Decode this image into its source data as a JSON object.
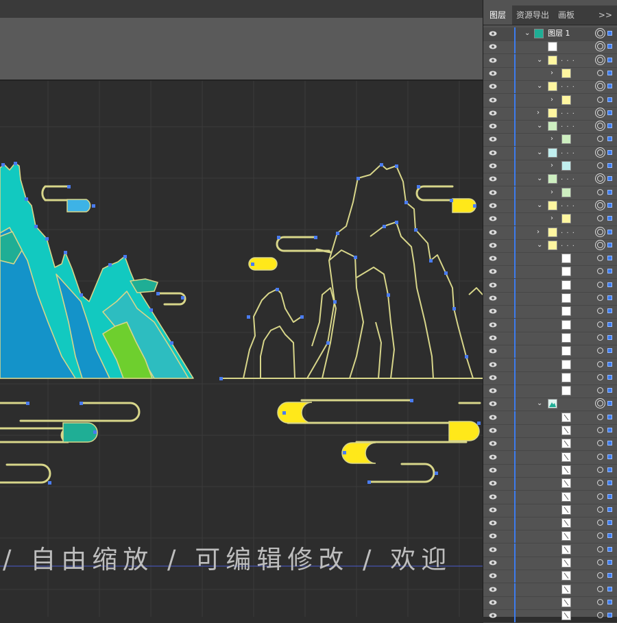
{
  "canvas": {
    "watermark_text": "/ 自由缩放 / 可编辑修改 / 欢迎",
    "colors": {
      "background": "#2d2d2d",
      "grid": "#3a3a3a",
      "outline": "#d8d68a",
      "anchor": "#4a7cf0",
      "teal": "#12c9c0",
      "blue": "#1493c9",
      "green": "#6ecf2e",
      "sky": "#3db3e6",
      "yellow": "#ffe81a",
      "jade": "#1fae95"
    }
  },
  "layers_panel": {
    "tabs": [
      "图层",
      "资源导出",
      "画板"
    ],
    "more_label": ">>",
    "top_layer_name": "图层 1",
    "rows": [
      {
        "indent": 0,
        "chev": "v",
        "thumb": "colored",
        "dots": false,
        "target": "double"
      },
      {
        "indent": 1,
        "chev": "",
        "thumb": "white",
        "dots": false,
        "target": "double"
      },
      {
        "indent": 1,
        "chev": "v",
        "thumb": "yellow",
        "dots": true,
        "target": "double"
      },
      {
        "indent": 2,
        "chev": ">",
        "thumb": "yellow",
        "dots": false,
        "target": "single"
      },
      {
        "indent": 1,
        "chev": "v",
        "thumb": "yellow",
        "dots": true,
        "target": "double"
      },
      {
        "indent": 2,
        "chev": ">",
        "thumb": "yellow",
        "dots": false,
        "target": "single"
      },
      {
        "indent": 1,
        "chev": ">",
        "thumb": "yellow",
        "dots": true,
        "target": "double"
      },
      {
        "indent": 1,
        "chev": "v",
        "thumb": "green",
        "dots": true,
        "target": "double"
      },
      {
        "indent": 2,
        "chev": ">",
        "thumb": "green",
        "dots": false,
        "target": "single"
      },
      {
        "indent": 1,
        "chev": "v",
        "thumb": "teal",
        "dots": true,
        "target": "double"
      },
      {
        "indent": 2,
        "chev": ">",
        "thumb": "teal",
        "dots": false,
        "target": "single"
      },
      {
        "indent": 1,
        "chev": "v",
        "thumb": "green",
        "dots": true,
        "target": "double"
      },
      {
        "indent": 2,
        "chev": ">",
        "thumb": "green",
        "dots": false,
        "target": "single"
      },
      {
        "indent": 1,
        "chev": "v",
        "thumb": "yellow",
        "dots": true,
        "target": "double"
      },
      {
        "indent": 2,
        "chev": ">",
        "thumb": "yellow",
        "dots": false,
        "target": "single"
      },
      {
        "indent": 1,
        "chev": ">",
        "thumb": "yellow",
        "dots": true,
        "target": "double"
      },
      {
        "indent": 1,
        "chev": "v",
        "thumb": "yellow",
        "dots": true,
        "target": "double"
      },
      {
        "indent": 2,
        "chev": "",
        "thumb": "white",
        "dots": false,
        "target": "single"
      },
      {
        "indent": 2,
        "chev": "",
        "thumb": "white",
        "dots": false,
        "target": "single"
      },
      {
        "indent": 2,
        "chev": "",
        "thumb": "white",
        "dots": false,
        "target": "single"
      },
      {
        "indent": 2,
        "chev": "",
        "thumb": "white",
        "dots": false,
        "target": "single"
      },
      {
        "indent": 2,
        "chev": "",
        "thumb": "white",
        "dots": false,
        "target": "single"
      },
      {
        "indent": 2,
        "chev": "",
        "thumb": "white",
        "dots": false,
        "target": "single"
      },
      {
        "indent": 2,
        "chev": "",
        "thumb": "white",
        "dots": false,
        "target": "single"
      },
      {
        "indent": 2,
        "chev": "",
        "thumb": "white",
        "dots": false,
        "target": "single"
      },
      {
        "indent": 2,
        "chev": "",
        "thumb": "white",
        "dots": false,
        "target": "single"
      },
      {
        "indent": 2,
        "chev": "",
        "thumb": "white",
        "dots": false,
        "target": "single"
      },
      {
        "indent": 2,
        "chev": "",
        "thumb": "white",
        "dots": false,
        "target": "single"
      },
      {
        "indent": 1,
        "chev": "v",
        "thumb": "mountain",
        "dots": false,
        "target": "double"
      },
      {
        "indent": 2,
        "chev": "",
        "thumb": "line",
        "dots": false,
        "target": "single"
      },
      {
        "indent": 2,
        "chev": "",
        "thumb": "line",
        "dots": false,
        "target": "single"
      },
      {
        "indent": 2,
        "chev": "",
        "thumb": "line",
        "dots": false,
        "target": "single"
      },
      {
        "indent": 2,
        "chev": "",
        "thumb": "line",
        "dots": false,
        "target": "single"
      },
      {
        "indent": 2,
        "chev": "",
        "thumb": "line",
        "dots": false,
        "target": "single"
      },
      {
        "indent": 2,
        "chev": "",
        "thumb": "line",
        "dots": false,
        "target": "single"
      },
      {
        "indent": 2,
        "chev": "",
        "thumb": "line",
        "dots": false,
        "target": "single"
      },
      {
        "indent": 2,
        "chev": "",
        "thumb": "line",
        "dots": false,
        "target": "single"
      },
      {
        "indent": 2,
        "chev": "",
        "thumb": "line",
        "dots": false,
        "target": "single"
      },
      {
        "indent": 2,
        "chev": "",
        "thumb": "line",
        "dots": false,
        "target": "single"
      },
      {
        "indent": 2,
        "chev": "",
        "thumb": "line",
        "dots": false,
        "target": "single"
      },
      {
        "indent": 2,
        "chev": "",
        "thumb": "line",
        "dots": false,
        "target": "single"
      },
      {
        "indent": 2,
        "chev": "",
        "thumb": "line",
        "dots": false,
        "target": "single"
      },
      {
        "indent": 2,
        "chev": "",
        "thumb": "line",
        "dots": false,
        "target": "single"
      },
      {
        "indent": 2,
        "chev": "",
        "thumb": "line",
        "dots": false,
        "target": "single"
      },
      {
        "indent": 2,
        "chev": "",
        "thumb": "line",
        "dots": false,
        "target": "single"
      }
    ]
  }
}
